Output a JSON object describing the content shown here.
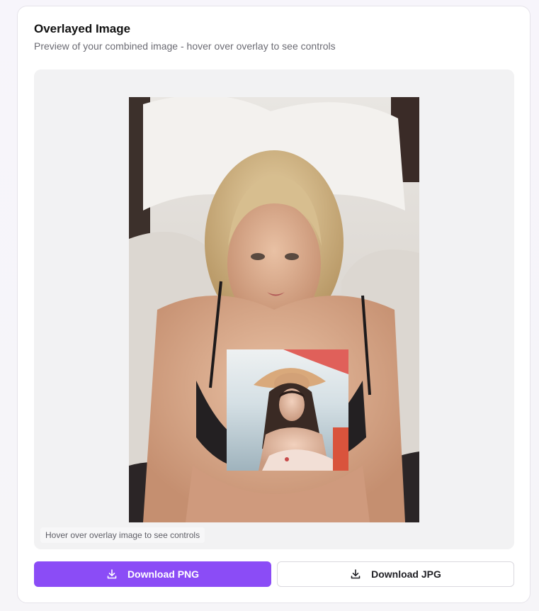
{
  "card": {
    "title": "Overlayed Image",
    "subtitle": "Preview of your combined image - hover over overlay to see controls"
  },
  "preview": {
    "hint": "Hover over overlay image to see controls"
  },
  "actions": {
    "download_png_label": "Download PNG",
    "download_jpg_label": "Download JPG"
  },
  "colors": {
    "accent": "#8b4cf6",
    "preview_bg": "#f2f2f3"
  },
  "icons": {
    "download": "download-icon"
  }
}
